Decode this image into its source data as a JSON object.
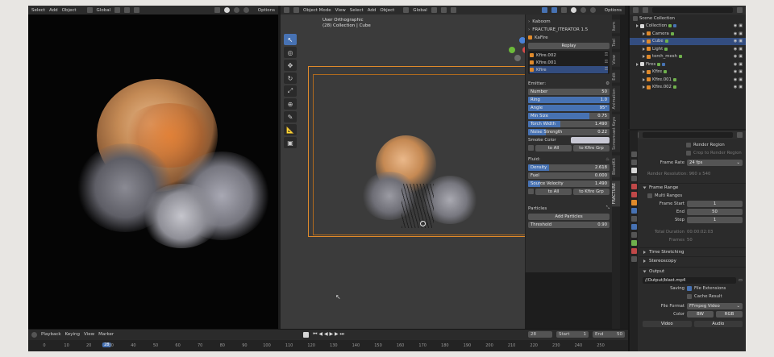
{
  "left_header": {
    "select": "Select",
    "add": "Add",
    "object": "Object",
    "orientation": "Global",
    "options": "Options"
  },
  "mid_header": {
    "mode": "Object Mode",
    "view": "View",
    "select": "Select",
    "add": "Add",
    "object": "Object",
    "orientation": "Global",
    "options": "Options"
  },
  "viewport": {
    "view_name": "User Orthographic",
    "collection": "(28) Collection | Cube"
  },
  "npanel": {
    "kaboom": "Kaboom",
    "iterator": "FRACTURE_ITERATOR 1.5",
    "kafire": "KaFire",
    "replay": "Replay",
    "fire_items": [
      "Kfire.002",
      "Kfire.001",
      "Kfire"
    ],
    "emitter_label": "Emitter:",
    "emitter_fields": [
      {
        "label": "Number",
        "value": "50",
        "fill": 0
      },
      {
        "label": "Ring",
        "value": "1.0",
        "fill": 1
      },
      {
        "label": "Angle",
        "value": "95°",
        "fill": 1
      },
      {
        "label": "Min Size",
        "value": "0.75",
        "fill": 0.75
      },
      {
        "label": "Torch Width",
        "value": "1.490",
        "fill": 0.4
      },
      {
        "label": "Noise Strength",
        "value": "0.22",
        "fill": 0.22
      }
    ],
    "smoke_color": "Smoke Color",
    "to_all": "to All",
    "to_kfire_grp": "to Kfire Grp",
    "fluid_label": "Fluid:",
    "fluid_fields": [
      {
        "label": "Density",
        "value": "2.618",
        "fill": 0.26
      },
      {
        "label": "Fuel",
        "value": "0.000",
        "fill": 0
      },
      {
        "label": "Source Velocity",
        "value": "1.490",
        "fill": 0.15
      }
    ],
    "particles_label": "Particles",
    "add_particles": "Add Particles",
    "threshold_label": "Threshold",
    "threshold_value": "0.90"
  },
  "ntabs": [
    "Item",
    "Tool",
    "View",
    "Edit",
    "Animation",
    "Screencast Keys",
    "BlendKit",
    "FRACTURE"
  ],
  "outliner": {
    "root": "Scene Collection",
    "rows": [
      {
        "label": "Collection",
        "indent": 0,
        "selected": false
      },
      {
        "label": "Camera",
        "indent": 1,
        "selected": false
      },
      {
        "label": "Cube",
        "indent": 1,
        "selected": true
      },
      {
        "label": "Light",
        "indent": 1,
        "selected": false
      },
      {
        "label": "torch_mesh",
        "indent": 1,
        "selected": false
      },
      {
        "label": "Fires",
        "indent": 0,
        "selected": false
      },
      {
        "label": "Kfire",
        "indent": 1,
        "selected": false
      },
      {
        "label": "Kfire.001",
        "indent": 1,
        "selected": false
      },
      {
        "label": "Kfire.002",
        "indent": 1,
        "selected": false
      }
    ]
  },
  "props": {
    "render_region": "Render Region",
    "crop": "Crop to Render Region",
    "frame_rate_label": "Frame Rate",
    "frame_rate_value": "24 fps",
    "render_resolution": "Render Resolution: 960 x 540",
    "frame_range": "Frame Range",
    "multi_ranges": "Multi Ranges",
    "frame_start_label": "Frame Start",
    "frame_start_value": "1",
    "end_label": "End",
    "end_value": "50",
    "step_label": "Step",
    "step_value": "1",
    "total_duration_label": "Total Duration",
    "total_duration_value": "00:00:02:03",
    "frames_label": "Frames",
    "frames_value": "50",
    "time_stretching": "Time Stretching",
    "stereoscopy": "Stereoscopy",
    "output": "Output",
    "output_path": "//Output/blast.mp4",
    "saving_label": "Saving",
    "file_extensions": "File Extensions",
    "cache_result": "Cache Result",
    "file_format_label": "File Format",
    "file_format_value": "FFmpeg Video",
    "color_label": "Color",
    "bw": "BW",
    "rgb": "RGB",
    "video": "Video",
    "audio": "Audio"
  },
  "timeline": {
    "playback": "Playback",
    "keying": "Keying",
    "view": "View",
    "marker": "Marker",
    "current_frame": "28",
    "start_label": "Start",
    "start_value": "1",
    "end_label": "End",
    "end_value": "50",
    "ticks": [
      "0",
      "10",
      "20",
      "30",
      "40",
      "50",
      "60",
      "70",
      "80",
      "90",
      "100",
      "110",
      "120",
      "130",
      "140",
      "150",
      "160",
      "170",
      "180",
      "190",
      "200",
      "210",
      "220",
      "230",
      "240",
      "250"
    ],
    "cursor_label": "28"
  },
  "colors": {
    "accent": "#4772b3",
    "selection": "#334d80",
    "bounds": "#e08a2b",
    "background": "#1d1d1d"
  }
}
